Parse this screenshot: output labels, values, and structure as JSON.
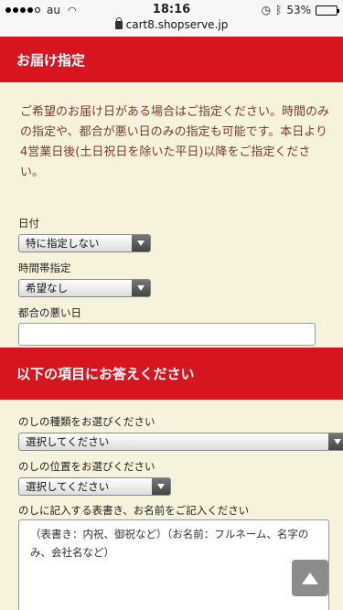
{
  "status": {
    "carrier": "au",
    "time": "18:16",
    "battery": "53%",
    "battery_level": 0.53,
    "url": "cart8.shopserve.jp"
  },
  "delivery": {
    "header": "お届け指定",
    "intro": "ご希望のお届け日がある場合はご指定ください。時間のみの指定や、都合が悪い日のみの指定も可能です。本日より4営業日後(土日祝日を除いた平日)以降をご指定ください。",
    "date_label": "日付",
    "date_value": "特に指定しない",
    "time_label": "時間帯指定",
    "time_value": "希望なし",
    "bad_day_label": "都合の悪い日",
    "bad_day_value": ""
  },
  "questions": {
    "header": "以下の項目にお答えください",
    "noshi_type_label": "のしの種類をお選びください",
    "noshi_type_value": "選択してください",
    "noshi_pos_label": "のしの位置をお選びください",
    "noshi_pos_value": "選択してください",
    "noshi_text_label": "のしに記入する表書き、お名前をご記入ください",
    "noshi_text_placeholder": "（表書き：内祝、御祝など）（お名前：フルネーム、名字のみ、会社名など）"
  },
  "icons": {
    "scroll_top": "triangle-up-icon",
    "lock": "lock-icon",
    "wifi": "wifi-icon",
    "bluetooth": "bluetooth-icon",
    "alarm": "alarm-icon"
  },
  "colors": {
    "header_red": "#d7151f",
    "background": "#f7f2dc",
    "intro_text": "#7a3b2e"
  }
}
